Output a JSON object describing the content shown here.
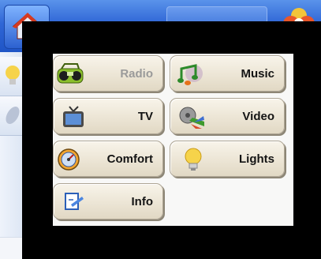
{
  "menu": {
    "radio": {
      "label": "Radio",
      "icon": "radio-icon",
      "enabled": false
    },
    "music": {
      "label": "Music",
      "icon": "music-notes-icon",
      "enabled": true
    },
    "tv": {
      "label": "TV",
      "icon": "television-icon",
      "enabled": true
    },
    "video": {
      "label": "Video",
      "icon": "film-reel-icon",
      "enabled": true
    },
    "comfort": {
      "label": "Comfort",
      "icon": "thermostat-icon",
      "enabled": true
    },
    "lights": {
      "label": "Lights",
      "icon": "light-bulb-icon",
      "enabled": true
    },
    "info": {
      "label": "Info",
      "icon": "info-document-icon",
      "enabled": true
    }
  },
  "colors": {
    "button_face": "#ece5d5",
    "button_border": "#aea594",
    "label_text": "#141414",
    "disabled_text": "#9a9a9a",
    "overlay": "#000000",
    "titlebar": "#2f66d6"
  }
}
